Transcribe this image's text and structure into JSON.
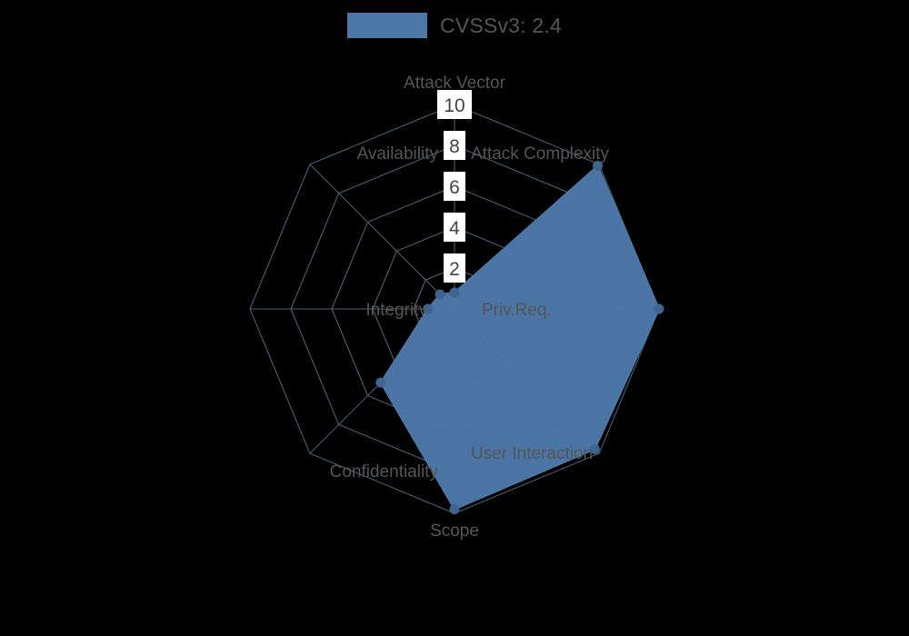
{
  "legend": {
    "label": "CVSSv3: 2.4",
    "swatch_color": "#4c78a8"
  },
  "colors": {
    "background": "#000000",
    "series": "#4c78a8",
    "grid": "#4a6071",
    "text": "#555555",
    "tick_text": "#444444",
    "tick_background": "#ffffff"
  },
  "chart_data": {
    "type": "radar",
    "title": "CVSSv3: 2.4",
    "categories": [
      "Attack Vector",
      "Attack Complexity",
      "Priv.Req.",
      "User Interaction",
      "Scope",
      "Confidentiality",
      "Integrity",
      "Availability"
    ],
    "series": [
      {
        "name": "CVSSv3: 2.4",
        "values": [
          0.8,
          9.9,
          10.0,
          9.7,
          9.8,
          5.1,
          1.3,
          1.0
        ]
      }
    ],
    "tick_labels": [
      "2",
      "4",
      "6",
      "8",
      "10"
    ],
    "tick_values": [
      2,
      4,
      6,
      8,
      10
    ],
    "rlim": [
      0,
      10
    ],
    "grid": true,
    "legend_position": "top-center",
    "xlabel": "",
    "ylabel": ""
  }
}
